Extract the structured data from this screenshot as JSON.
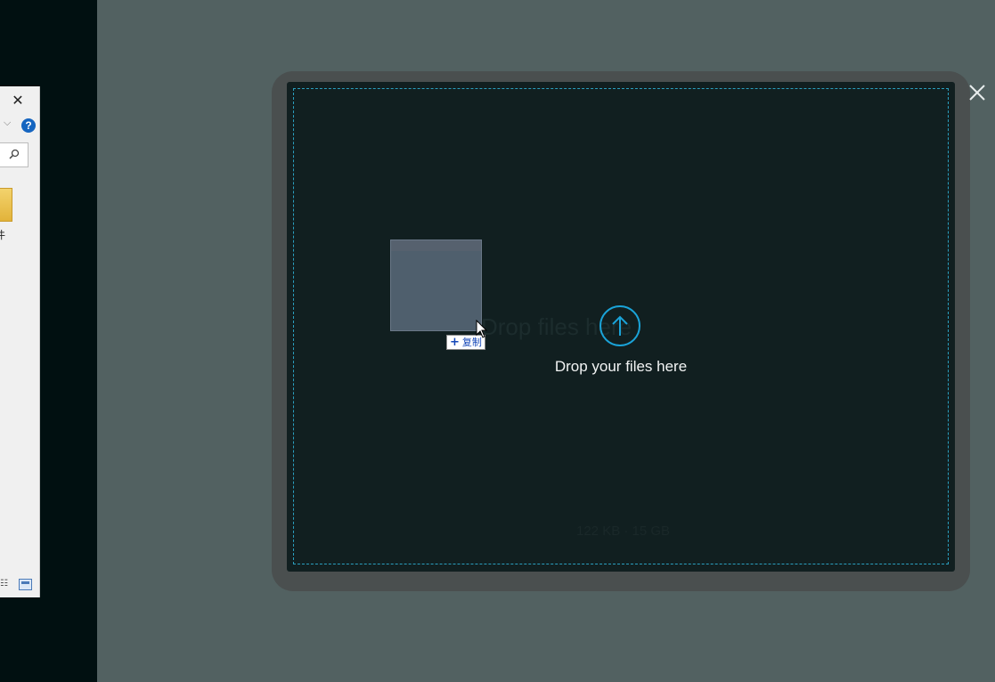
{
  "explorer": {
    "close_glyph": "✕",
    "chevron_glyph": "⌵",
    "help_glyph": "?",
    "folder_label": "件",
    "search_icon": "search-icon",
    "view_details_glyph": "☷",
    "view_tiles_icon": "tiles-view-icon"
  },
  "drop_modal": {
    "title": "Drop your files here",
    "ghost_title": "Drop files here",
    "ghost_size": "122 KB · 15 GB",
    "upload_icon": "upload-arrow-icon",
    "close_icon": "close-icon",
    "accent_color": "#1aa3d8"
  },
  "drag": {
    "badge_plus": "+",
    "badge_label": "复制"
  }
}
